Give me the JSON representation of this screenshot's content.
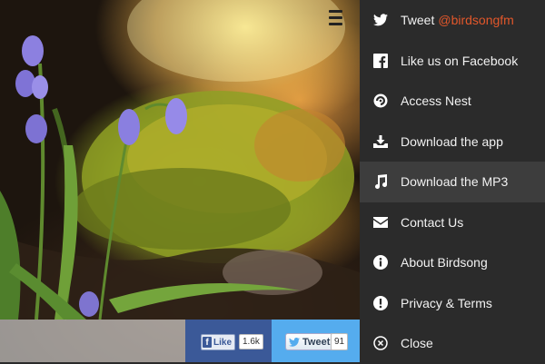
{
  "share": {
    "facebook": {
      "label": "Like",
      "count": "1.6k"
    },
    "twitter": {
      "label": "Tweet",
      "count": "91"
    }
  },
  "menu": {
    "items": [
      {
        "id": "tweet",
        "label": "Tweet",
        "handle": "@birdsongfm",
        "icon": "twitter-icon"
      },
      {
        "id": "facebook",
        "label": "Like us on Facebook",
        "icon": "facebook-icon"
      },
      {
        "id": "nest",
        "label": "Access Nest",
        "icon": "nest-icon"
      },
      {
        "id": "app",
        "label": "Download the app",
        "icon": "download-icon"
      },
      {
        "id": "mp3",
        "label": "Download the MP3",
        "icon": "music-note-icon"
      },
      {
        "id": "contact",
        "label": "Contact Us",
        "icon": "envelope-icon"
      },
      {
        "id": "about",
        "label": "About Birdsong",
        "icon": "info-icon"
      },
      {
        "id": "privacy",
        "label": "Privacy & Terms",
        "icon": "exclamation-icon"
      },
      {
        "id": "close",
        "label": "Close",
        "icon": "close-icon"
      }
    ],
    "active": "Download the MP3"
  },
  "colors": {
    "menu_bg": "#2b2b2b",
    "active_bg": "#3d3d3d",
    "handle": "#e2572b",
    "facebook": "#3b5998",
    "twitter": "#55acee"
  }
}
